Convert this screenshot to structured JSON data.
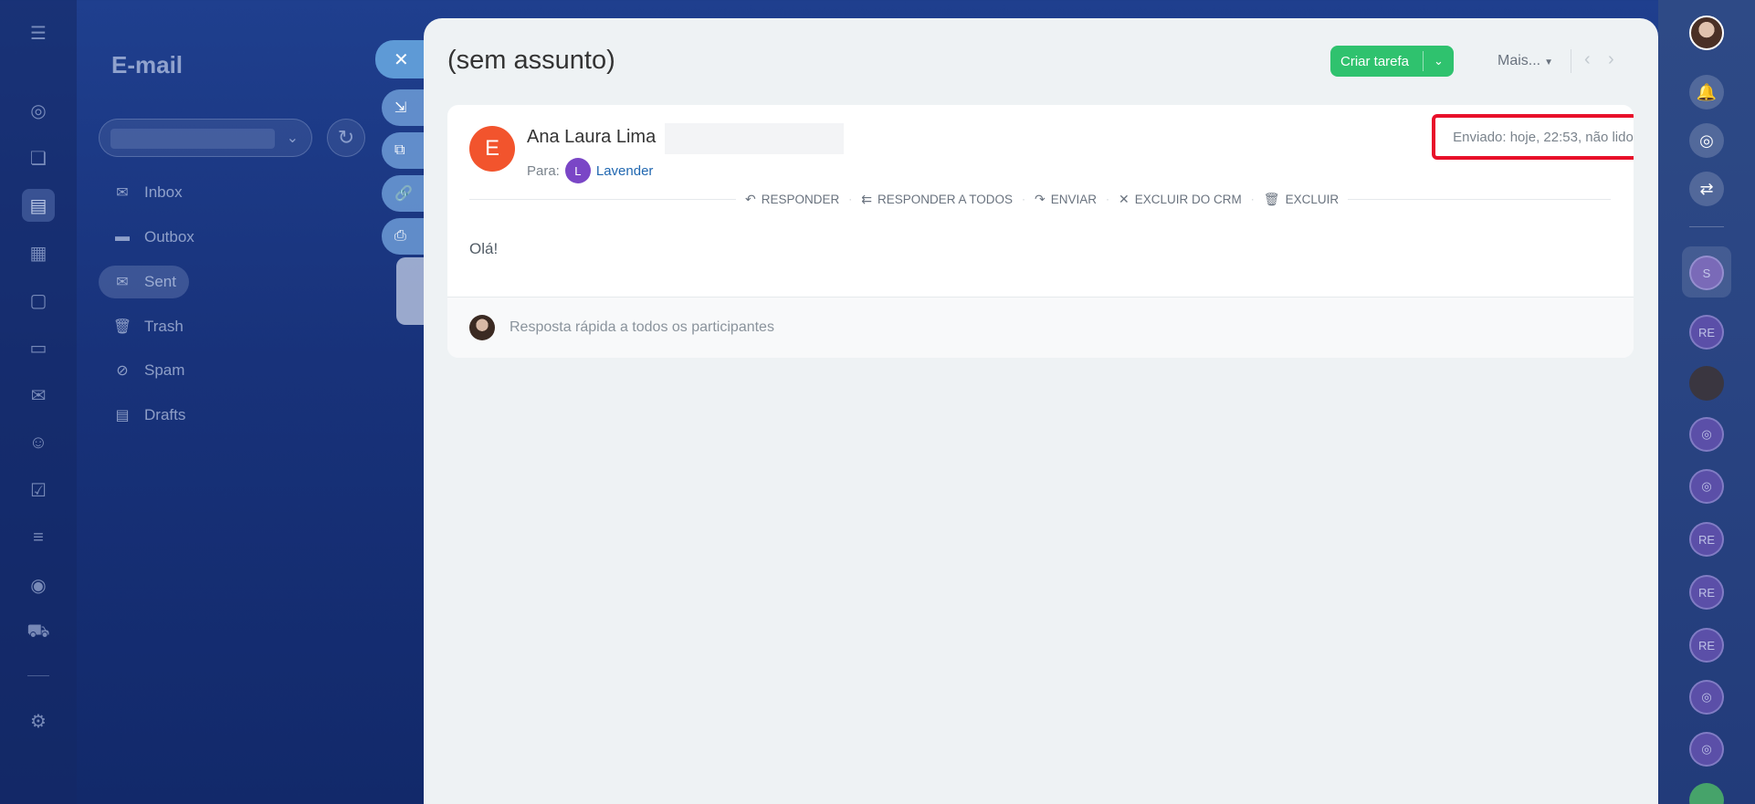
{
  "left_rail": {
    "icons": [
      "feed-icon",
      "chat-icon",
      "tasks-icon",
      "calendar-icon",
      "documents-icon",
      "drive-icon",
      "mail-icon",
      "contacts-icon",
      "checklist-icon",
      "funnel-icon",
      "target-icon",
      "shop-icon",
      "settings-icon"
    ]
  },
  "mail_sidebar": {
    "title": "E-mail",
    "folders": [
      {
        "label": "Inbox",
        "icon": "envelope-icon"
      },
      {
        "label": "Outbox",
        "icon": "folder-icon"
      },
      {
        "label": "Sent",
        "icon": "sent-icon"
      },
      {
        "label": "Trash",
        "icon": "trash-icon"
      },
      {
        "label": "Spam",
        "icon": "spam-icon"
      },
      {
        "label": "Drafts",
        "icon": "drafts-icon"
      }
    ]
  },
  "panel": {
    "subject": "(sem assunto)",
    "create_task": "Criar tarefa",
    "more": "Mais...",
    "close_glyph": "✕"
  },
  "message": {
    "sender_initial": "E",
    "sender_name": "Ana Laura Lima",
    "to_label": "Para:",
    "recipient_initial": "L",
    "recipient_name": "Lavender",
    "sent_info": "Enviado: hoje, 22:53, não lido",
    "actions": {
      "reply": "RESPONDER",
      "reply_all": "RESPONDER A TODOS",
      "forward": "ENVIAR",
      "remove_crm": "EXCLUIR DO CRM",
      "delete": "EXCLUIR"
    },
    "body": "Olá!",
    "quick_reply_placeholder": "Resposta rápida a todos os participantes"
  },
  "right_rail": {
    "chat_initials": [
      "S",
      "RE",
      "RE",
      "RE",
      "RE"
    ]
  },
  "colors": {
    "accent_green": "#2fc26e",
    "link_blue": "#2067b0",
    "highlight_red": "#e8102a",
    "sender_avatar": "#f2542d",
    "recipient_avatar": "#7a46c6"
  }
}
